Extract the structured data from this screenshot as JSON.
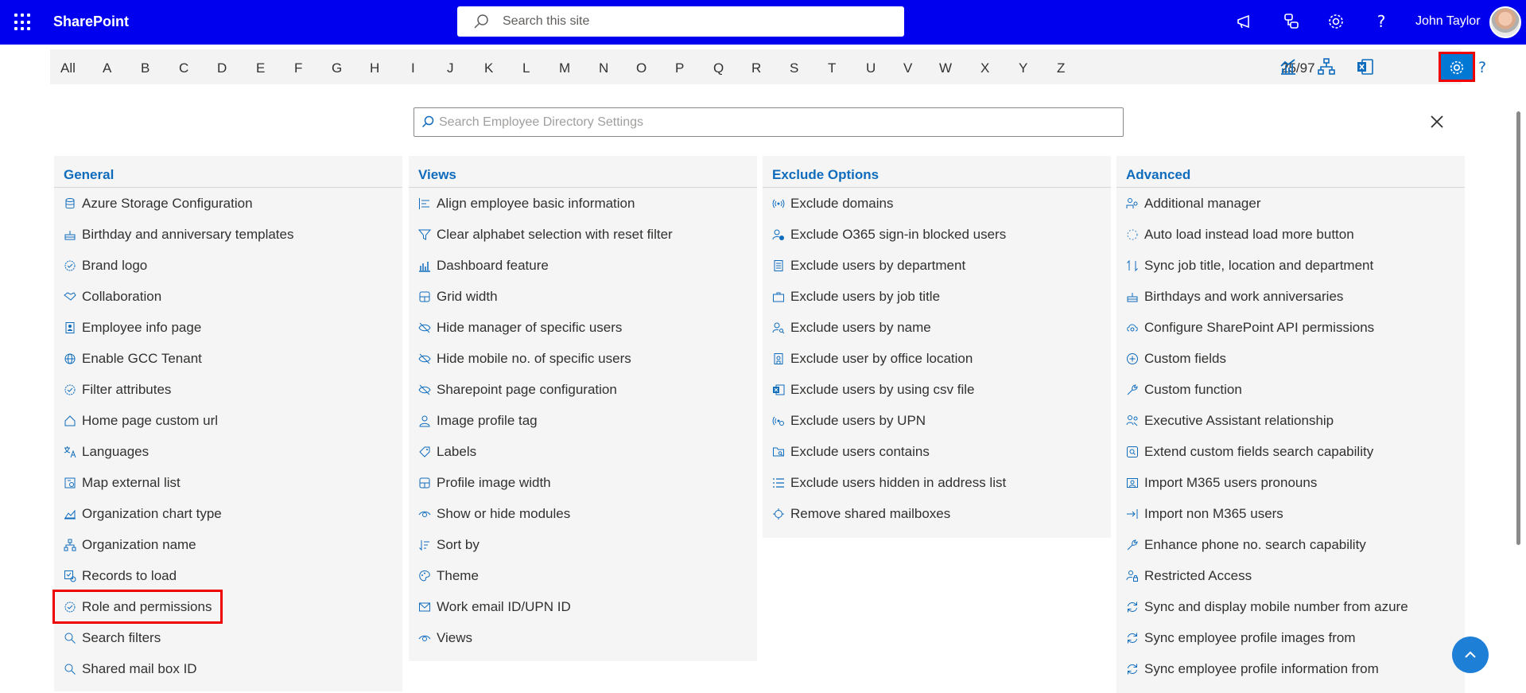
{
  "header": {
    "app_name": "SharePoint",
    "search_placeholder": "Search this site",
    "user_name": "John Taylor",
    "icons": [
      "waffle-icon",
      "megaphone-icon",
      "share-icon",
      "gear-icon",
      "help-icon"
    ]
  },
  "alphabet_bar": {
    "letters": [
      "All",
      "A",
      "B",
      "C",
      "D",
      "E",
      "F",
      "G",
      "H",
      "I",
      "J",
      "K",
      "L",
      "M",
      "N",
      "O",
      "P",
      "Q",
      "R",
      "S",
      "T",
      "U",
      "V",
      "W",
      "X",
      "Y",
      "Z"
    ],
    "count": "25/97",
    "tools": [
      "dashboard-chart-icon",
      "org-chart-icon",
      "excel-icon",
      "settings-gear-icon",
      "help-icon"
    ]
  },
  "settings_search": {
    "placeholder": "Search Employee Directory Settings"
  },
  "columns": [
    {
      "title": "General",
      "items": [
        "Azure Storage Configuration",
        "Birthday and anniversary templates",
        "Brand logo",
        "Collaboration",
        "Employee info page",
        "Enable GCC Tenant",
        "Filter attributes",
        "Home page custom url",
        "Languages",
        "Map external list",
        "Organization chart type",
        "Organization name",
        "Records to load",
        "Role and permissions",
        "Search filters",
        "Shared mail box ID"
      ]
    },
    {
      "title": "Views",
      "items": [
        "Align employee basic information",
        "Clear alphabet selection with reset filter",
        "Dashboard feature",
        "Grid width",
        "Hide manager of specific users",
        "Hide mobile no. of specific users",
        "Sharepoint page configuration",
        "Image profile tag",
        "Labels",
        "Profile image width",
        "Show or hide modules",
        "Sort by",
        "Theme",
        "Work email ID/UPN ID",
        "Views"
      ]
    },
    {
      "title": "Exclude Options",
      "items": [
        "Exclude domains",
        "Exclude O365 sign-in blocked users",
        "Exclude users by department",
        "Exclude users by job title",
        "Exclude users by name",
        "Exclude user by office location",
        "Exclude users by using csv file",
        "Exclude users by UPN",
        "Exclude users contains",
        "Exclude users hidden in address list",
        "Remove shared mailboxes"
      ]
    },
    {
      "title": "Advanced",
      "items": [
        "Additional manager",
        "Auto load instead load more button",
        "Sync job title, location and department",
        "Birthdays and work anniversaries",
        "Configure SharePoint API permissions",
        "Custom fields",
        "Custom function",
        "Executive Assistant relationship",
        "Extend custom fields search capability",
        "Import M365 users pronouns",
        "Import non M365 users",
        "Enhance phone no. search capability",
        "Restricted Access",
        "Sync and display mobile number from azure",
        "Sync employee profile images from",
        "Sync employee profile information from"
      ]
    }
  ],
  "colors": {
    "topbar": "#0000ee",
    "accent": "#0f6cbd",
    "highlight": "#e00000"
  }
}
